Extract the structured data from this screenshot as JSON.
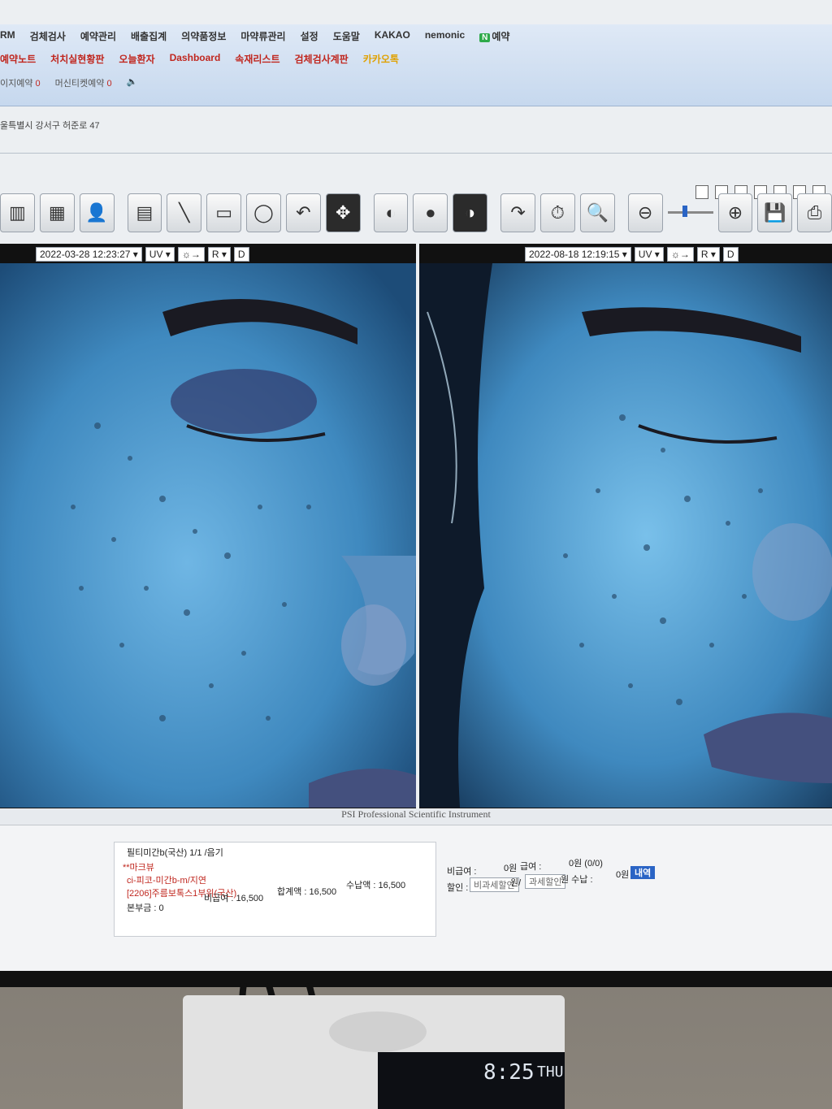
{
  "menu": {
    "row1": [
      "RM",
      "검체검사",
      "예약관리",
      "배출집계",
      "의약품정보",
      "마약류관리",
      "설정",
      "도움말",
      "KAKAO",
      "nemonic",
      "예약"
    ],
    "row2": [
      "예약노트",
      "처치실현황판",
      "오늘환자",
      "Dashboard",
      "속재리스트",
      "검체검사계판",
      "카카오톡"
    ],
    "row3": [
      "이지예약",
      "0",
      "머신티켓예약",
      "0"
    ]
  },
  "address": "울특별시 강서구 허준로 47",
  "left_pane": {
    "datetime": "2022-03-28 12:23:27",
    "mode": "UV",
    "side": "R",
    "flag": "D"
  },
  "right_pane": {
    "datetime": "2022-08-18 12:19:15",
    "mode": "UV",
    "side": "R",
    "flag": "D"
  },
  "footer_brand": "PSI Professional Scientific Instrument",
  "orders": {
    "line1": "필티미간b(국산) 1/1 /음기",
    "line2": "**마크뷰",
    "line3": "ci-피코-미간b-m/지연",
    "line4": "[2206]주름보톡스1부위(국산)",
    "line5": "본부금 : 0",
    "non_insured": "비급여 : 16,500",
    "total": "합계액 : 16,500",
    "received": "수납액 : 16,500"
  },
  "billing": {
    "non_insured_label": "비급여 :",
    "non_insured_value": "0원",
    "insured_label": "급여 :",
    "insured_value": "0원 (0/0)",
    "discount_label": "할인 :",
    "discount_taxfree": "비과세할인",
    "discount_unit": "원/",
    "discount_tax": "과세할인",
    "receive_label": "원 수납 :",
    "receive_value": "0원",
    "detail_btn": "내역"
  },
  "clock": {
    "time": "8:25",
    "day": "THU"
  }
}
